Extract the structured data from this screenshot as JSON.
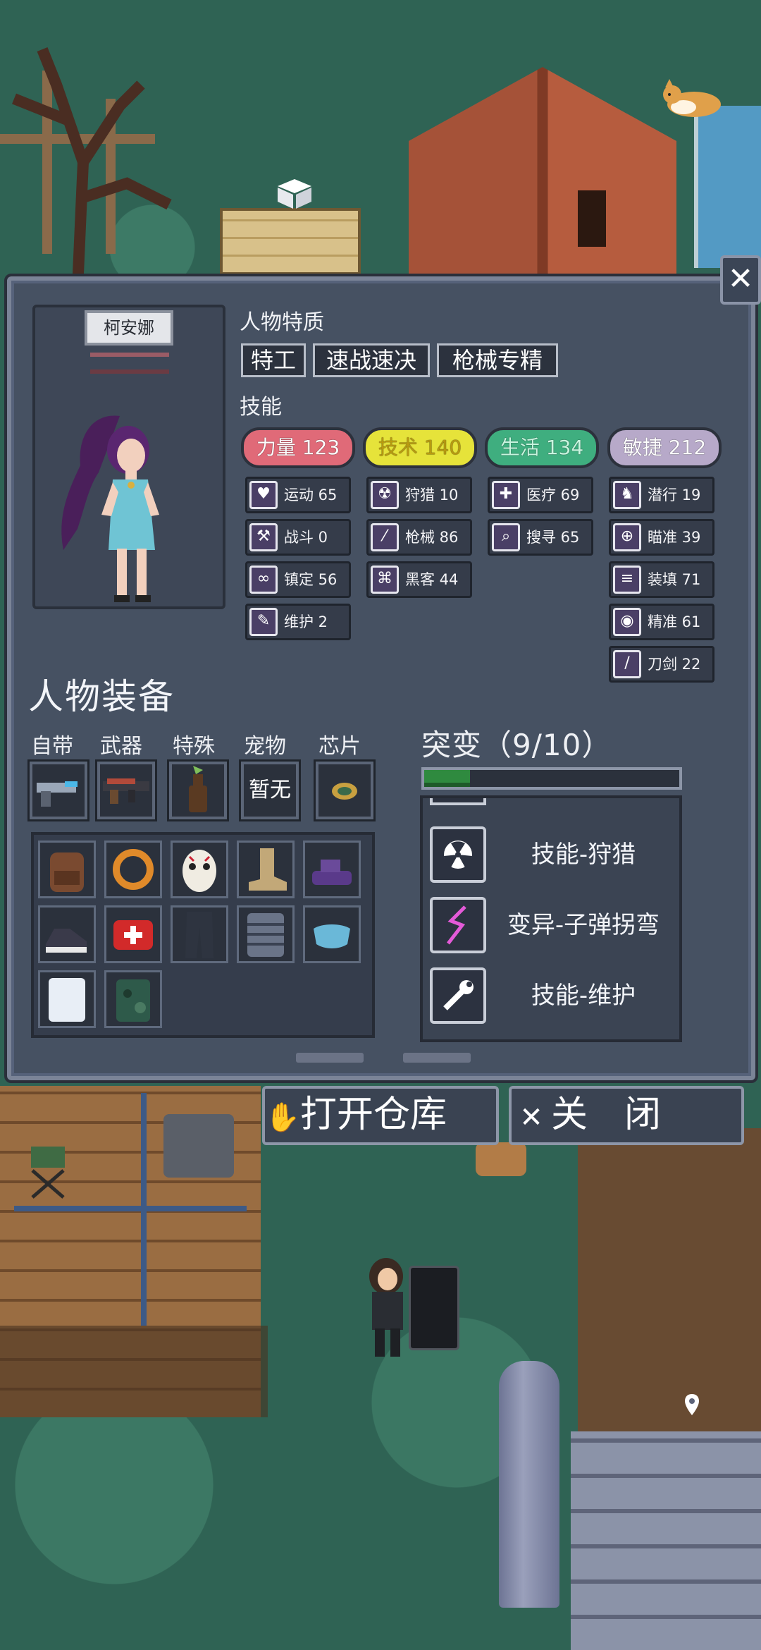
{
  "character": {
    "name": "柯安娜"
  },
  "traits": {
    "label": "人物特质",
    "items": [
      "特工",
      "速战速决",
      "枪械专精"
    ]
  },
  "skills": {
    "label": "技能",
    "categories": [
      {
        "name": "力量",
        "value": "123",
        "color": "#e06a78"
      },
      {
        "name": "技术",
        "value": "140",
        "color": "#e6e33a"
      },
      {
        "name": "生活",
        "value": "134",
        "color": "#3fae7f"
      },
      {
        "name": "敏捷",
        "value": "212",
        "color": "#b7a9c9"
      }
    ],
    "list": {
      "col1": [
        {
          "label": "运动 65",
          "icon": "heart-icon"
        },
        {
          "label": "战斗 0",
          "icon": "axe-icon"
        },
        {
          "label": "镇定 56",
          "icon": "glasses-icon"
        },
        {
          "label": "维护 2",
          "icon": "wrench-icon"
        }
      ],
      "col2": [
        {
          "label": "狩猎 10",
          "icon": "radiation-icon"
        },
        {
          "label": "枪械 86",
          "icon": "bullet-icon"
        },
        {
          "label": "黑客 44",
          "icon": "circuit-icon"
        }
      ],
      "col3": [
        {
          "label": "医疗 69",
          "icon": "medkit-icon"
        },
        {
          "label": "搜寻 65",
          "icon": "magnifier-icon"
        }
      ],
      "col4": [
        {
          "label": "潜行 19",
          "icon": "sneak-icon"
        },
        {
          "label": "瞄准 39",
          "icon": "crosshair-icon"
        },
        {
          "label": "装填 71",
          "icon": "magazine-icon"
        },
        {
          "label": "精准 61",
          "icon": "eye-icon"
        },
        {
          "label": "刀剑 22",
          "icon": "blade-icon"
        }
      ]
    }
  },
  "equipment": {
    "title": "人物装备",
    "slots": [
      {
        "label": "自带",
        "item": "pistol-icon"
      },
      {
        "label": "武器",
        "item": "rifle-icon"
      },
      {
        "label": "特殊",
        "item": "molotov-icon"
      },
      {
        "label": "宠物",
        "empty_text": "暂无"
      },
      {
        "label": "芯片",
        "item": "chip-icon"
      }
    ],
    "inventory": [
      "backpack-icon",
      "ring-icon",
      "hockey-mask-icon",
      "boot-icon",
      "purple-shoes-icon",
      "sneaker-icon",
      "first-aid-icon",
      "pants-icon",
      "armor-vest-icon",
      "face-mask-icon",
      "white-shirt-icon",
      "camo-vest-icon"
    ]
  },
  "mutation": {
    "title": "突变（9/10）",
    "progress": 0.18,
    "items": [
      {
        "label": "技能-狩猎",
        "icon": "radiation-icon"
      },
      {
        "label": "变异-子弹拐弯",
        "icon": "lightning-icon"
      },
      {
        "label": "技能-维护",
        "icon": "wrench-icon"
      }
    ]
  },
  "buttons": {
    "open_storage": "打开仓库",
    "close": "关　闭",
    "close_x": "✕"
  }
}
